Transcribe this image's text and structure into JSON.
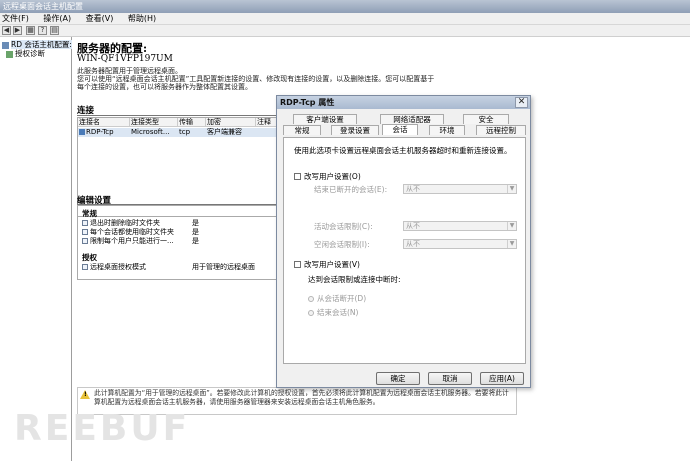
{
  "window": {
    "title": "远程桌面会话主机配置"
  },
  "menu": {
    "items": [
      "文件(F)",
      "操作(A)",
      "查看(V)",
      "帮助(H)"
    ]
  },
  "tree": {
    "items": [
      {
        "label": "RD 会话主机配置:",
        "icon": "server-icon"
      },
      {
        "label": "授权诊断",
        "icon": "diagnostics-icon"
      }
    ]
  },
  "main": {
    "title": "服务器的配置:",
    "server_name": "WIN-QF1VFP197UM",
    "desc": [
      "此服务器配置用于管理远程桌面。",
      "您可以使用“远程桌面会话主机配置”工具配置新连接的设置、修改现有连接的设置，以及删除连接。您可以配置基于",
      "每个连接的设置，也可以将服务器作为整体配置其设置。"
    ],
    "connections_heading": "连接",
    "columns": [
      "连接名",
      "连接类型",
      "传输",
      "加密",
      "注释"
    ],
    "row": [
      "RDP-Tcp",
      "Microsoft...",
      "tcp",
      "客户端兼容",
      ""
    ],
    "edit_heading": "编辑设置",
    "general_group": "常规",
    "general_rows": [
      {
        "label": "退出时删除临时文件夹",
        "value": "是"
      },
      {
        "label": "每个会话都使用临时文件夹",
        "value": "是"
      },
      {
        "label": "限制每个用户只能进行一...",
        "value": "是"
      }
    ],
    "license_group": "授权",
    "license_rows": [
      {
        "label": "远程桌面授权模式",
        "value": "用于管理的远程桌面"
      }
    ],
    "notice": "此计算机配置为“用于管理的远程桌面”。若要修改此计算机的授权设置，首先必须将此计算机配置为远程桌面会话主机服务器。若要将此计算机配置为远程桌面会话主机服务器，请使用服务器管理器来安装远程桌面会话主机角色服务。"
  },
  "watermark": "REEBUF",
  "dialog": {
    "title": "RDP-Tcp 属性",
    "close": "✕",
    "tabs_row1": [
      "客户端设置",
      "网络适配器",
      "安全"
    ],
    "tabs_row2": [
      "常规",
      "登录设置",
      "会话",
      "环境",
      "远程控制"
    ],
    "active_tab": "会话",
    "intro": "使用此选项卡设置远程桌面会话主机服务器超时和重新连接设置。",
    "override1": "改写用户设置(O)",
    "end_disconnected": "结束已断开的会话(E):",
    "active_limit": "活动会话限制(C):",
    "idle_limit": "空闲会话限制(I):",
    "combo_value": "从不",
    "override2": "改写用户设置(V)",
    "reach_limit": "达到会话限制或连接中断时:",
    "opt_disconnect": "从会话断开(D)",
    "opt_end": "结束会话(N)",
    "btn_ok": "确定",
    "btn_cancel": "取消",
    "btn_apply": "应用(A)"
  }
}
